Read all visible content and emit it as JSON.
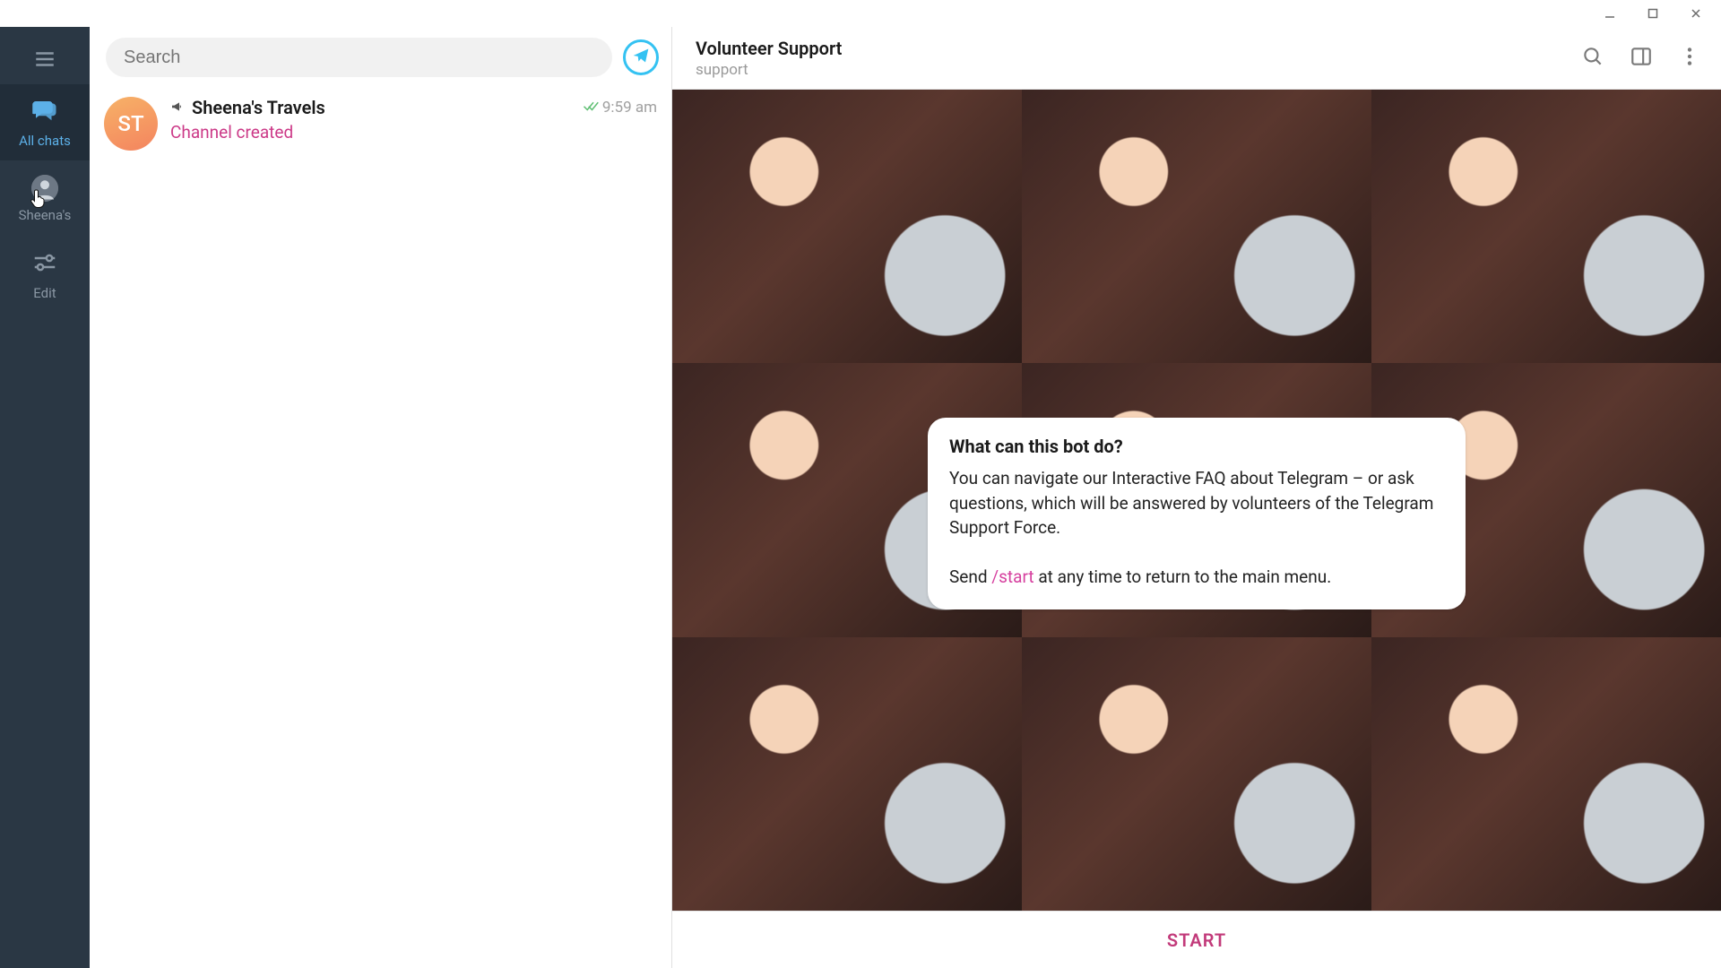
{
  "window": {
    "minimize": "min",
    "maximize": "max",
    "close": "close"
  },
  "rail": {
    "all_chats": "All chats",
    "folder": "Sheena's",
    "edit": "Edit"
  },
  "search": {
    "placeholder": "Search"
  },
  "chats": [
    {
      "avatar_initials": "ST",
      "name": "Sheena's Travels",
      "preview": "Channel created",
      "time": "9:59 am"
    }
  ],
  "conversation": {
    "title": "Volunteer Support",
    "status": "support",
    "bot_card": {
      "heading": "What can this bot do?",
      "para1": "You can navigate our Interactive FAQ about Telegram – or ask questions, which will be answered by volunteers of the Telegram Support Force.",
      "para2_pre": "Send ",
      "command": "/start",
      "para2_post": " at any time to return to the main menu."
    },
    "start_button": "START"
  }
}
